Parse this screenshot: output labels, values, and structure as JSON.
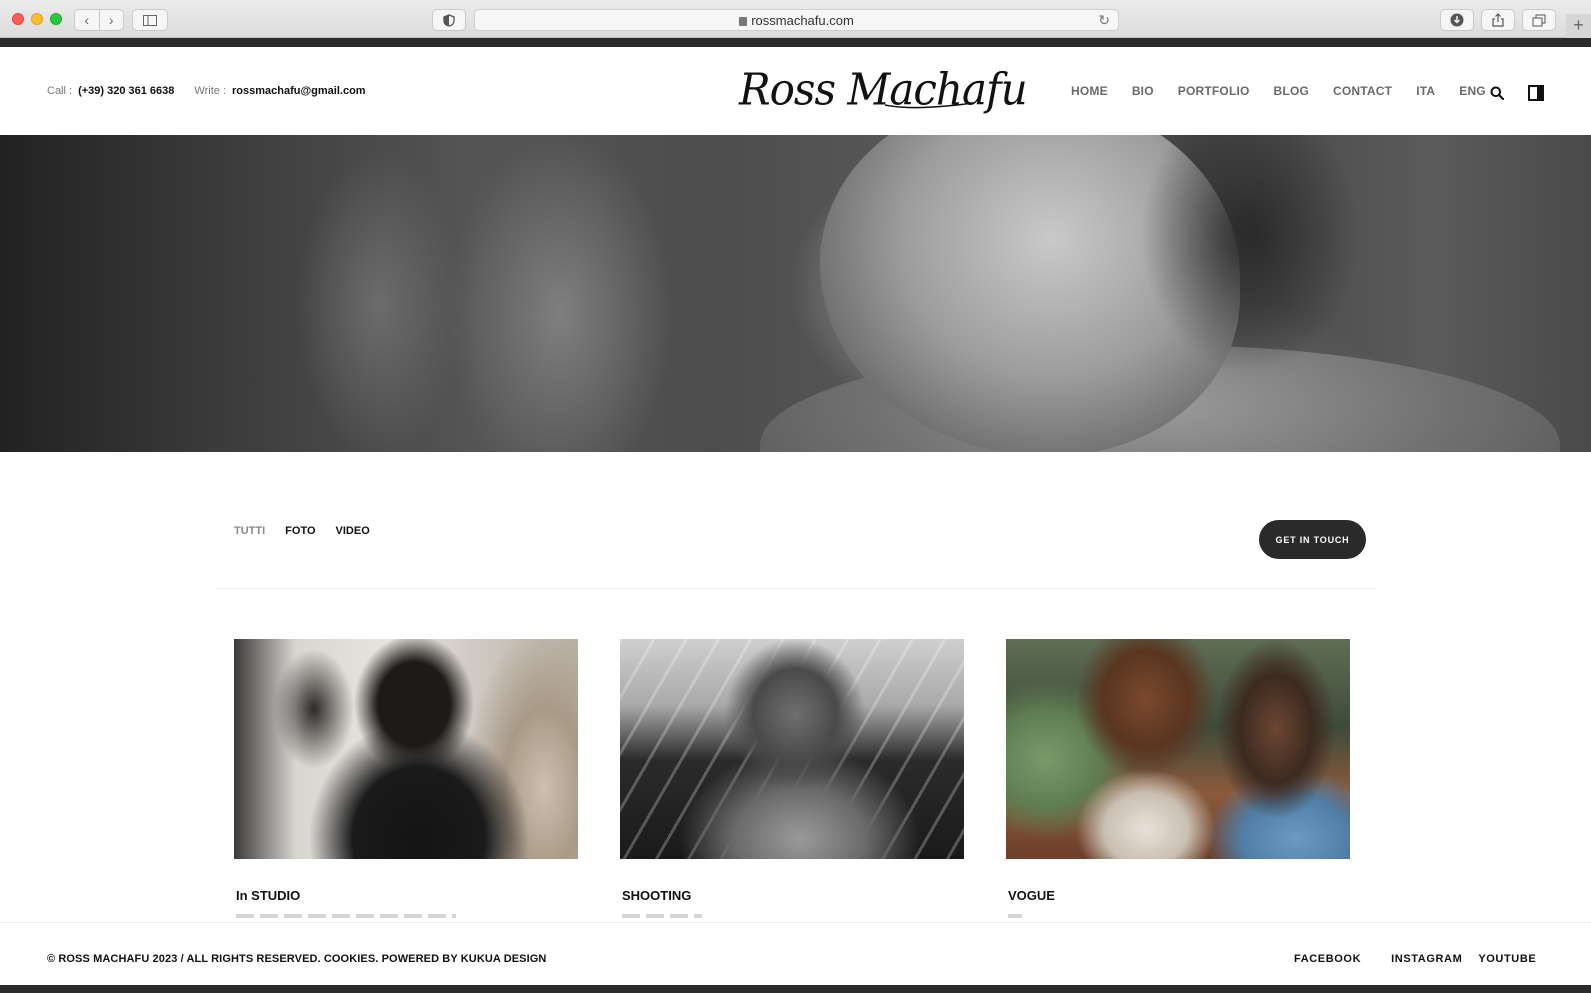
{
  "browser": {
    "url": "rossmachafu.com"
  },
  "header": {
    "call_label": "Call :",
    "call_value": "(+39) 320 361 6638",
    "write_label": "Write :",
    "write_value": "rossmachafu@gmail.com",
    "logo_text": "Ross Machafu",
    "nav": [
      "HOME",
      "BIO",
      "PORTFOLIO",
      "BLOG",
      "CONTACT",
      "ITA",
      "ENG"
    ]
  },
  "filters": {
    "items": [
      "TUTTI",
      "FOTO",
      "VIDEO"
    ],
    "cta": "GET IN TOUCH"
  },
  "portfolio": [
    {
      "title": "In STUDIO"
    },
    {
      "title": "SHOOTING"
    },
    {
      "title": "VOGUE"
    }
  ],
  "footer": {
    "copyright": "© ROSS MACHAFU 2023 / ALL RIGHTS RESERVED. COOKIES. POWERED BY KUKUA DESIGN",
    "social": [
      "FACEBOOK",
      "INSTAGRAM",
      "YOUTUBE"
    ]
  },
  "colors": {
    "dark_button": "#2a2a2a",
    "nav_text": "#6a6a6a",
    "text": "#111111"
  }
}
